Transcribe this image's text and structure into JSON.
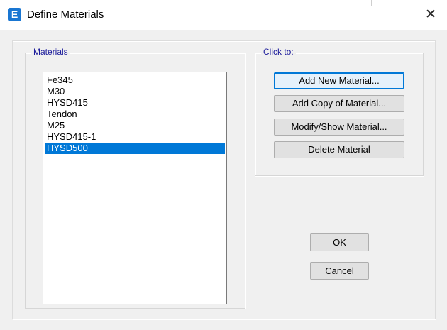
{
  "window": {
    "title": "Define Materials",
    "app_icon_letter": "E",
    "close_glyph": "✕"
  },
  "materials_group": {
    "label": "Materials",
    "items": [
      "Fe345",
      "M30",
      "HYSD415",
      "Tendon",
      "M25",
      "HYSD415-1",
      "HYSD500"
    ],
    "selected": "HYSD500"
  },
  "click_to_group": {
    "label": "Click to:",
    "buttons": {
      "add_new": "Add New Material...",
      "add_copy": "Add Copy of Material...",
      "modify_show": "Modify/Show Material...",
      "delete": "Delete Material"
    }
  },
  "dialog_buttons": {
    "ok": "OK",
    "cancel": "Cancel"
  },
  "colors": {
    "selection": "#0078d7",
    "group_label": "#1a1a9a",
    "app_icon": "#1976d2"
  }
}
